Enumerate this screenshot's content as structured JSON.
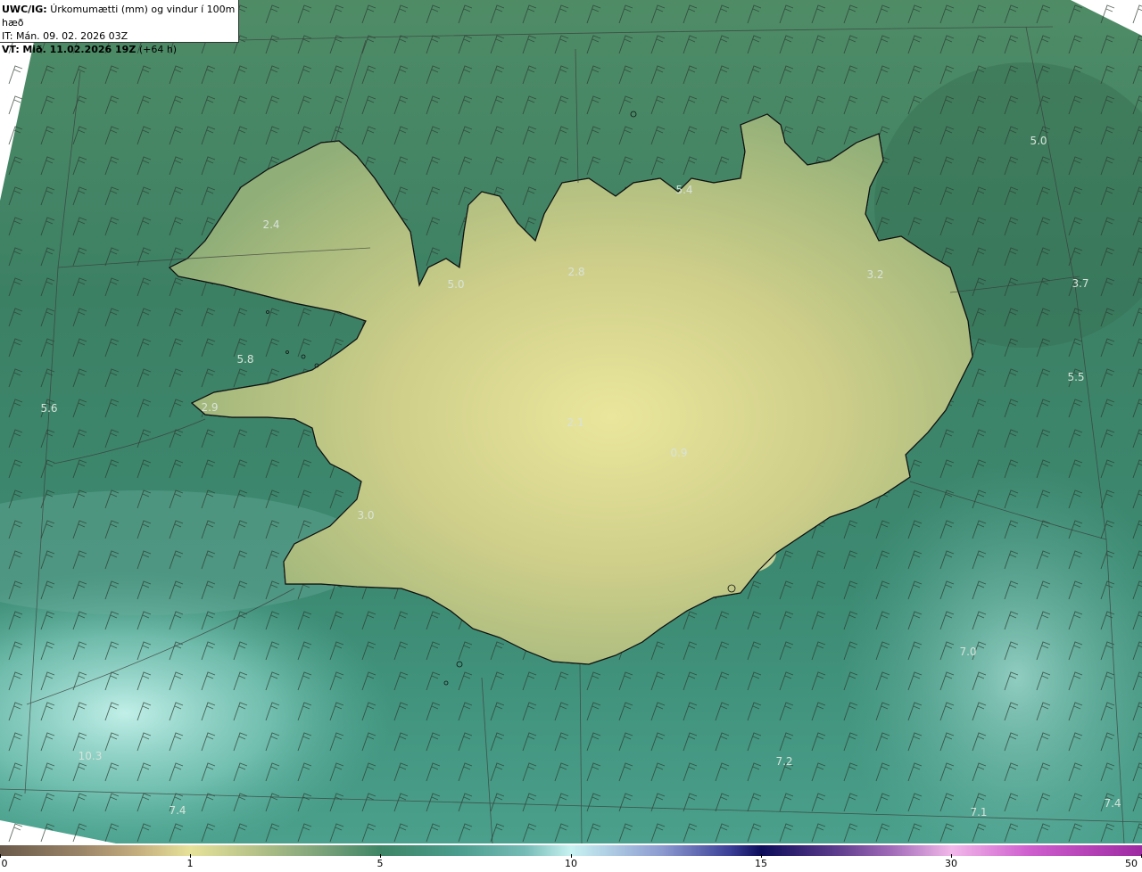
{
  "header": {
    "model": "UWC/IG:",
    "title": "Úrkomumætti (mm) og vindur í 100m hæð",
    "init_label": "IT:",
    "init_time": "Mán. 09. 02. 2026 03Z",
    "valid_label": "VT:",
    "valid_time": "Mið. 11.02.2026 19Z",
    "lead": "(+64 h)"
  },
  "map_labels": [
    {
      "id": "l1",
      "text": "5.0"
    },
    {
      "id": "l2",
      "text": "5.4"
    },
    {
      "id": "l3",
      "text": "2.4"
    },
    {
      "id": "l4",
      "text": "5.0"
    },
    {
      "id": "l5",
      "text": "2.8"
    },
    {
      "id": "l6",
      "text": "3.2"
    },
    {
      "id": "l7",
      "text": "3.7"
    },
    {
      "id": "l8",
      "text": "5.8"
    },
    {
      "id": "l9",
      "text": "5.6"
    },
    {
      "id": "l10",
      "text": "2.9"
    },
    {
      "id": "l11",
      "text": "5.5"
    },
    {
      "id": "l12",
      "text": "2.1"
    },
    {
      "id": "l13",
      "text": "0.9"
    },
    {
      "id": "l14",
      "text": "3.0"
    },
    {
      "id": "l15",
      "text": "7.0"
    },
    {
      "id": "l16",
      "text": "10.3"
    },
    {
      "id": "l17",
      "text": "7.2"
    },
    {
      "id": "l18",
      "text": "7.4"
    },
    {
      "id": "l19",
      "text": "7.1"
    },
    {
      "id": "l20",
      "text": "7.4"
    }
  ],
  "colorbar": {
    "ticks": [
      "0",
      "1",
      "5",
      "10",
      "15",
      "30",
      "50"
    ]
  },
  "colors": {
    "ocean_deep": "#2f7a62",
    "ocean_light": "#9fe0d8",
    "land_high": "#e8e498",
    "coastline": "#111111",
    "grid": "#444444"
  }
}
